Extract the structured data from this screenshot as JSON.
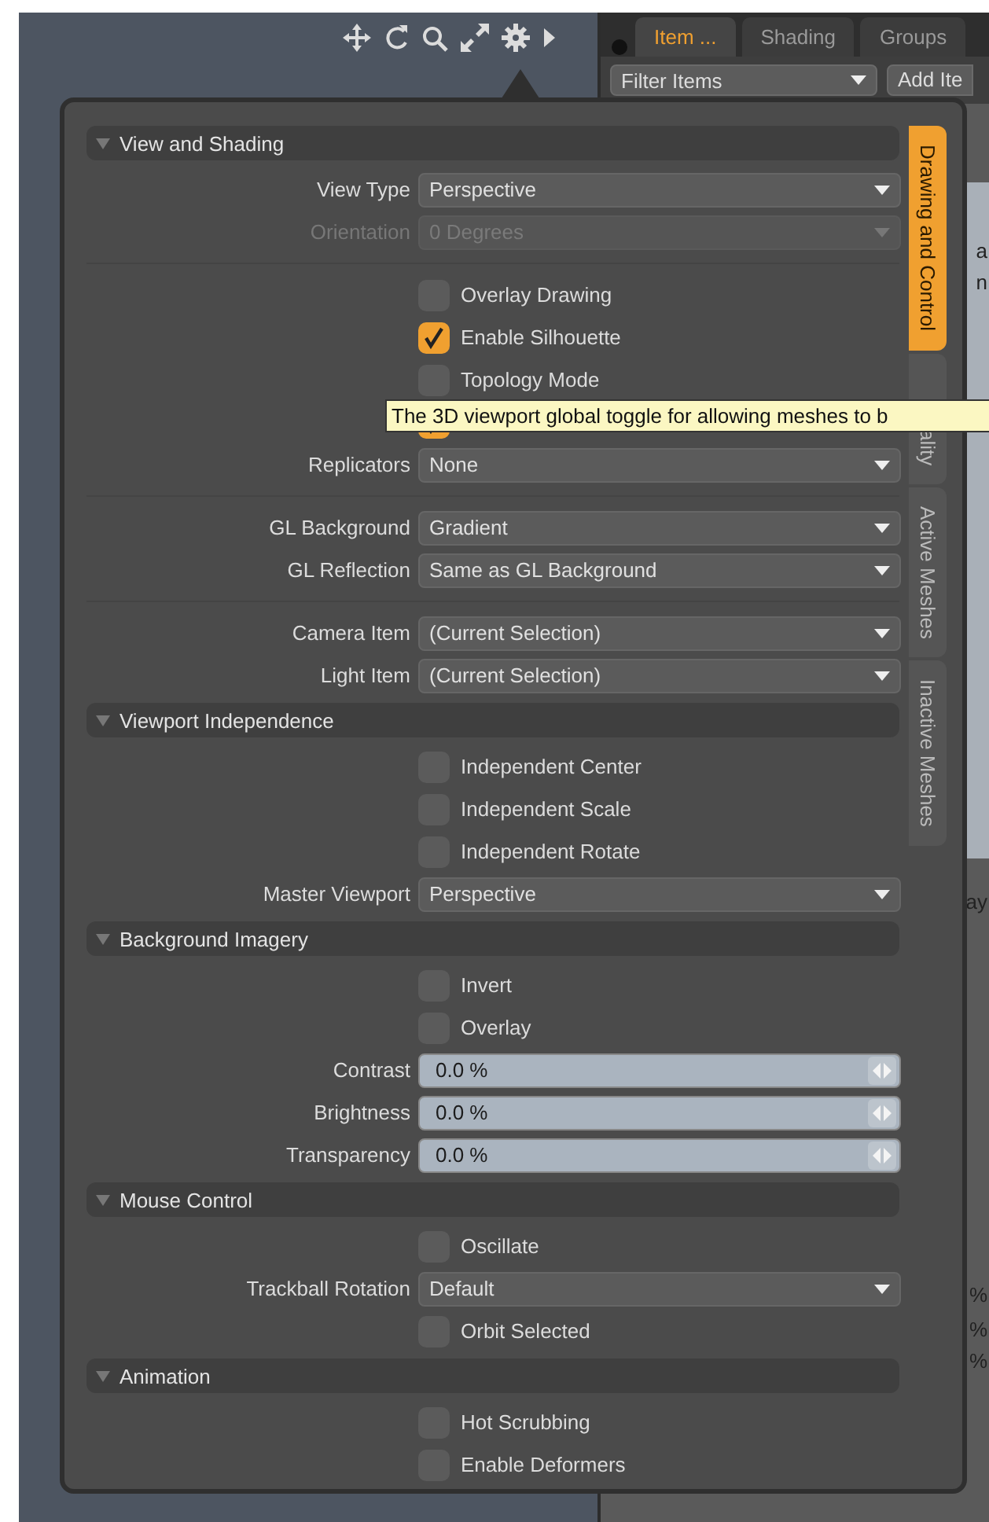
{
  "panel_tabs": [
    {
      "label": "Item ...",
      "selected": true
    },
    {
      "label": "Shading",
      "selected": false
    },
    {
      "label": "Groups",
      "selected": false
    }
  ],
  "filter_field": {
    "value": "Filter Items"
  },
  "add_button": "Add Ite",
  "background_fragments": [
    "a",
    "n",
    "ay",
    "%",
    "%",
    "%"
  ],
  "popup": {
    "sections": [
      {
        "title": "View and Shading",
        "expanded": true,
        "groups": [
          {
            "rows": [
              {
                "kind": "dropdown",
                "label": "View Type",
                "value": "Perspective",
                "disabled": false
              },
              {
                "kind": "dropdown",
                "label": "Orientation",
                "value": "0 Degrees",
                "disabled": true
              }
            ]
          },
          {
            "rows": [
              {
                "kind": "checkbox",
                "label": "Overlay Drawing",
                "checked": false
              },
              {
                "kind": "checkbox",
                "label": "Enable Silhouette",
                "checked": true
              },
              {
                "kind": "checkbox",
                "label": "Topology Mode",
                "checked": false
              },
              {
                "kind": "checkbox",
                "checked": true
              },
              {
                "kind": "dropdown",
                "label": "Replicators",
                "value": "None",
                "disabled": false
              }
            ]
          },
          {
            "rows": [
              {
                "kind": "dropdown",
                "label": "GL Background",
                "value": "Gradient",
                "disabled": false
              },
              {
                "kind": "dropdown",
                "label": "GL Reflection",
                "value": "Same as GL Background",
                "disabled": false
              }
            ]
          },
          {
            "rows": [
              {
                "kind": "dropdown",
                "label": "Camera Item",
                "value": "(Current Selection)",
                "disabled": false
              },
              {
                "kind": "dropdown",
                "label": "Light Item",
                "value": "(Current Selection)",
                "disabled": false
              }
            ]
          }
        ]
      },
      {
        "title": "Viewport Independence",
        "expanded": true,
        "groups": [
          {
            "rows": [
              {
                "kind": "checkbox",
                "label": "Independent Center",
                "checked": false
              },
              {
                "kind": "checkbox",
                "label": "Independent Scale",
                "checked": false
              },
              {
                "kind": "checkbox",
                "label": "Independent Rotate",
                "checked": false
              },
              {
                "kind": "dropdown",
                "label": "Master Viewport",
                "value": "Perspective",
                "disabled": false
              }
            ]
          }
        ]
      },
      {
        "title": "Background Imagery",
        "expanded": true,
        "groups": [
          {
            "rows": [
              {
                "kind": "checkbox",
                "label": "Invert",
                "checked": false
              },
              {
                "kind": "checkbox",
                "label": "Overlay",
                "checked": false
              },
              {
                "kind": "number",
                "label": "Contrast",
                "value": "0.0 %"
              },
              {
                "kind": "number",
                "label": "Brightness",
                "value": "0.0 %"
              },
              {
                "kind": "number",
                "label": "Transparency",
                "value": "0.0 %"
              }
            ]
          }
        ]
      },
      {
        "title": "Mouse Control",
        "expanded": true,
        "groups": [
          {
            "rows": [
              {
                "kind": "checkbox",
                "label": "Oscillate",
                "checked": false
              },
              {
                "kind": "dropdown",
                "label": "Trackball Rotation",
                "value": "Default",
                "disabled": false
              },
              {
                "kind": "checkbox",
                "label": "Orbit Selected",
                "checked": false
              }
            ]
          }
        ]
      },
      {
        "title": "Animation",
        "expanded": true,
        "groups": [
          {
            "rows": [
              {
                "kind": "checkbox",
                "label": "Hot Scrubbing",
                "checked": false
              },
              {
                "kind": "checkbox",
                "label": "Enable Deformers",
                "checked": false
              }
            ]
          }
        ]
      }
    ],
    "side_tabs": [
      {
        "label": "Drawing and Control",
        "selected": true
      },
      {
        "label": "ality",
        "selected": false
      },
      {
        "label": "Active Meshes",
        "selected": false
      },
      {
        "label": "Inactive Meshes",
        "selected": false
      }
    ],
    "tooltip": "The 3D viewport global toggle for allowing meshes to b"
  }
}
